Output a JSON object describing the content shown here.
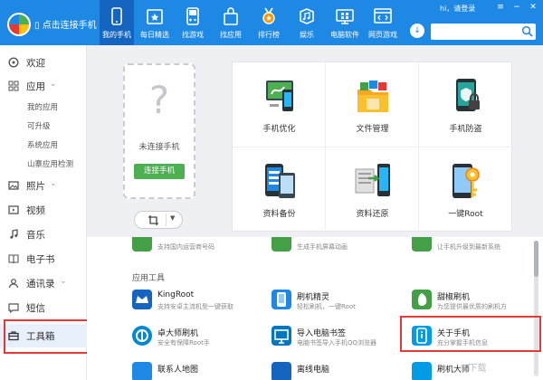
{
  "header": {
    "connect_label": "点击连接手机",
    "login_text": "hi，请登录",
    "tabs": [
      {
        "label": "我的手机",
        "icon": "phone-icon"
      },
      {
        "label": "每日精选",
        "icon": "calendar-star-icon"
      },
      {
        "label": "找游戏",
        "icon": "gameboy-icon"
      },
      {
        "label": "找应用",
        "icon": "bag-icon"
      },
      {
        "label": "排行榜",
        "icon": "medal-icon"
      },
      {
        "label": "娱乐",
        "icon": "music-icon"
      },
      {
        "label": "电脑软件",
        "icon": "monitor-icon"
      },
      {
        "label": "网页游戏",
        "icon": "browser-icon"
      }
    ],
    "window_buttons": {
      "menu": "≡",
      "minimize": "−",
      "close": "✕"
    }
  },
  "sidebar": {
    "items": [
      {
        "label": "欢迎",
        "icon": "welcome-icon"
      },
      {
        "label": "应用",
        "icon": "apps-icon",
        "chevron": "⌄"
      },
      {
        "label": "照片",
        "icon": "photo-icon",
        "chevron": "⌄"
      },
      {
        "label": "视频",
        "icon": "video-icon"
      },
      {
        "label": "音乐",
        "icon": "music-note-icon"
      },
      {
        "label": "电子书",
        "icon": "book-icon"
      },
      {
        "label": "通讯录",
        "icon": "contacts-icon",
        "chevron": "⌄"
      },
      {
        "label": "短信",
        "icon": "sms-icon"
      },
      {
        "label": "工具箱",
        "icon": "toolbox-icon"
      }
    ],
    "app_sub_items": [
      "我的应用",
      "可升级",
      "系统应用",
      "山寨应用检测"
    ]
  },
  "phone_card": {
    "placeholder": "?",
    "not_connected": "未连接手机",
    "connect_button": "连接手机"
  },
  "tools": [
    {
      "label": "手机优化",
      "icon": "phone-optimize-icon"
    },
    {
      "label": "文件管理",
      "icon": "file-manage-icon"
    },
    {
      "label": "手机防盗",
      "icon": "anti-theft-icon"
    },
    {
      "label": "资料备份",
      "icon": "backup-icon"
    },
    {
      "label": "资料还原",
      "icon": "restore-icon"
    },
    {
      "label": "一键Root",
      "icon": "root-key-icon"
    }
  ],
  "top_row_partial": [
    "支持国内运营商号码",
    "生成手机屏幕动画",
    "让手机升级到最新系统"
  ],
  "section_title": "应用工具",
  "app_tools": [
    {
      "name": "KingRoot",
      "desc": "支持安卓主流机型一键获取",
      "icon": "kingroot-icon",
      "color": "#1565c0"
    },
    {
      "name": "刷机精灵",
      "desc": "轻松刷机，一键Root",
      "icon": "flash-wizard-icon",
      "color": "#1e88e5"
    },
    {
      "name": "甜椒刷机",
      "desc": "为您提供最优质的刷机方",
      "icon": "pepper-flash-icon",
      "color": "#43a047"
    },
    {
      "name": "卓大师刷机",
      "desc": "安全有保障Root手",
      "icon": "zhuo-master-icon",
      "color": "#0288d1"
    },
    {
      "name": "导入电脑书签",
      "desc": "电脑书签导入手机QQ浏览器",
      "icon": "bookmark-import-icon",
      "color": "#0277bd"
    },
    {
      "name": "关于手机",
      "desc": "充分掌握手机信息",
      "icon": "about-phone-icon",
      "color": "#039be5"
    },
    {
      "name": "联系人地图",
      "desc": "",
      "icon": "contacts-map-icon",
      "color": "#1e88e5"
    },
    {
      "name": "离线电脑",
      "desc": "",
      "icon": "offline-pc-icon",
      "color": "#1565c0"
    },
    {
      "name": "刷机大师",
      "desc": "",
      "icon": "flash-master-icon",
      "color": "#039be5"
    }
  ],
  "watermark": "3 下载"
}
